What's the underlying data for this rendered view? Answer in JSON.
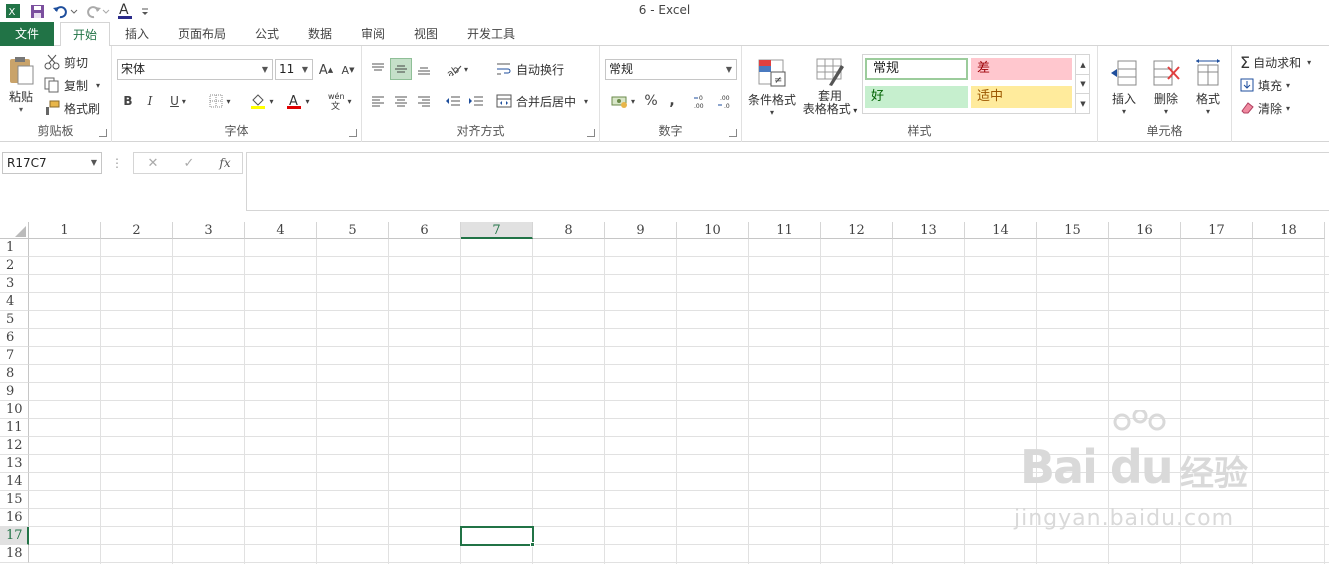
{
  "window": {
    "title": "6 - Excel"
  },
  "tabs": [
    "文件",
    "开始",
    "插入",
    "页面布局",
    "公式",
    "数据",
    "审阅",
    "视图",
    "开发工具"
  ],
  "clipboard": {
    "paste": "粘贴",
    "cut": "剪切",
    "copy": "复制",
    "format_painter": "格式刷",
    "label": "剪贴板"
  },
  "font": {
    "name": "宋体",
    "size": "11",
    "label": "字体",
    "phonetic": "wén"
  },
  "alignment": {
    "wrap": "自动换行",
    "merge": "合并后居中",
    "label": "对齐方式"
  },
  "number": {
    "format": "常规",
    "label": "数字",
    "percent": "%",
    "comma": ","
  },
  "styles": {
    "conditional": "条件格式",
    "table_1": "套用",
    "table_2": "表格格式",
    "normal": "常规",
    "bad": "差",
    "good": "好",
    "neutral": "适中",
    "label": "样式",
    "colors": {
      "normal_border": "#9ccc9c",
      "bad_bg": "#ffc7ce",
      "bad_fg": "#9c0006",
      "good_bg": "#c6efce",
      "good_fg": "#006100",
      "neutral_bg": "#ffeb9c",
      "neutral_fg": "#9c5700"
    }
  },
  "cells": {
    "insert": "插入",
    "delete": "删除",
    "format": "格式",
    "label": "单元格"
  },
  "editing": {
    "autosum": "自动求和",
    "fill": "填充",
    "clear": "清除"
  },
  "formula_bar": {
    "name_box": "R17C7",
    "cancel": "✕",
    "enter": "✓",
    "fx": "fx",
    "formula": ""
  },
  "grid": {
    "columns": [
      "1",
      "2",
      "3",
      "4",
      "5",
      "6",
      "7",
      "8",
      "9",
      "10",
      "11",
      "12",
      "13",
      "14",
      "15",
      "16",
      "17",
      "18"
    ],
    "rows": [
      "1",
      "2",
      "3",
      "4",
      "5",
      "6",
      "7",
      "8",
      "9",
      "10",
      "11",
      "12",
      "13",
      "14",
      "15",
      "16",
      "17",
      "18"
    ],
    "selected_col": "7",
    "selected_row": "17"
  },
  "watermark": {
    "brand": "Bai du",
    "cn": "经验",
    "url": "jingyan.baidu.com"
  },
  "accent": "#217346"
}
